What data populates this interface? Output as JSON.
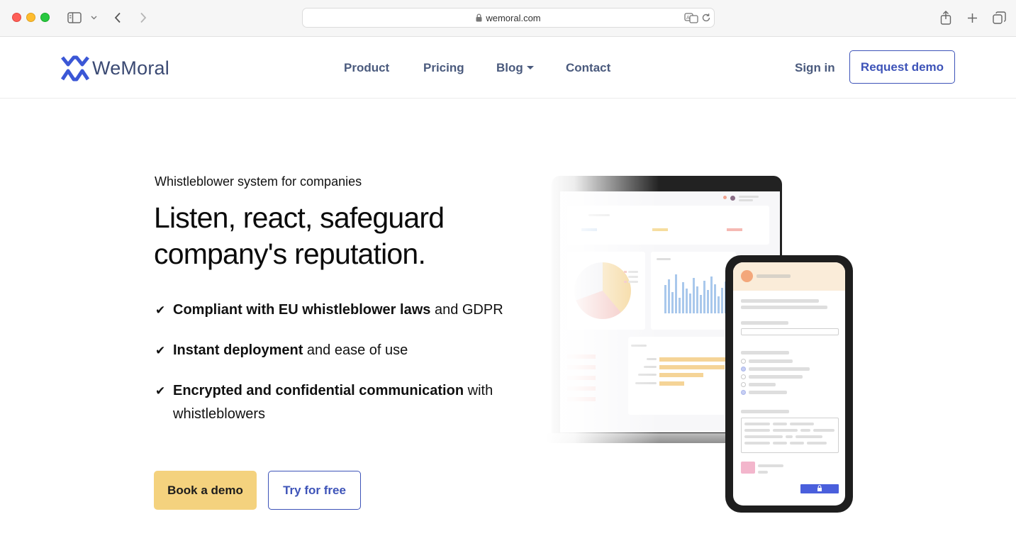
{
  "browser": {
    "url": "wemoral.com"
  },
  "nav": {
    "logo_text": "WeMoral",
    "links": [
      "Product",
      "Pricing",
      "Blog",
      "Contact"
    ],
    "sign_in": "Sign in",
    "request_demo": "Request demo"
  },
  "hero": {
    "eyebrow": "Whistleblower system for companies",
    "headline_line1": "Listen, react, safeguard",
    "headline_line2": "company's reputation.",
    "features": [
      {
        "check": "✔",
        "bold": "Compliant with EU whistleblower laws",
        "rest": " and GDPR"
      },
      {
        "check": "✔",
        "bold": "Instant deployment",
        "rest": " and ease of use"
      },
      {
        "check": "✔",
        "bold": "Encrypted and confidential communication",
        "rest": " with whistleblowers"
      }
    ],
    "book_demo": "Book a demo",
    "try_free": "Try for free"
  },
  "colors": {
    "brand_blue": "#3d53b8",
    "nav_text": "#4a5a7d",
    "book_demo_bg": "#f4d27e"
  },
  "icons": [
    "sidebar-icon",
    "chevron-down-icon",
    "back-icon",
    "forward-icon",
    "lock-icon",
    "translate-icon",
    "reload-icon",
    "share-icon",
    "new-tab-icon",
    "tabs-overview-icon",
    "check-icon"
  ]
}
